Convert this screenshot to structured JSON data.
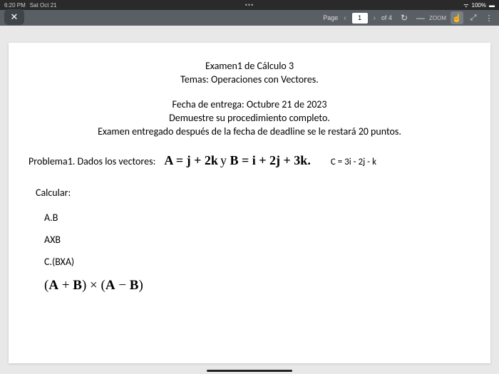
{
  "status": {
    "time": "6:20 PM",
    "date": "Sat Oct 21",
    "dots": "•••",
    "battery": "100%",
    "wifi": "⚲"
  },
  "toolbar": {
    "close": "✕",
    "page_label": "Page",
    "prev": "‹",
    "next": "›",
    "page_current": "1",
    "page_total": "of 4",
    "reload": "↻",
    "minus": "—",
    "zoom": "ZOOM",
    "hand": "☝",
    "expand": "⤢",
    "menu": "⋮"
  },
  "doc": {
    "title": "Examen1 de Cálculo 3",
    "subtitle": "Temas: Operaciones con  Vectores.",
    "date": "Fecha de entrega:  Octubre 21 de 2023",
    "instr1": "Demuestre  su procedimiento  completo.",
    "instr2": "Examen entregado después de la fecha de deadline se le restará 20 puntos.",
    "problem_label": "Problema1. Dados los vectores:",
    "vec_a_pre": "A = j + 2k",
    "vec_y": " y ",
    "vec_b": "B = i + 2j + 3k.",
    "vec_c": "C = 3i  -  2j  - k",
    "calc_label": "Calcular:",
    "item1": "A.B",
    "item2": "AXB",
    "item3": "C.(BXA)",
    "expr_ab_open": "(",
    "expr_a": "A",
    "expr_plus": " + ",
    "expr_b": "B",
    "expr_close": ")",
    "expr_times": " × ",
    "expr_minus": " − "
  }
}
